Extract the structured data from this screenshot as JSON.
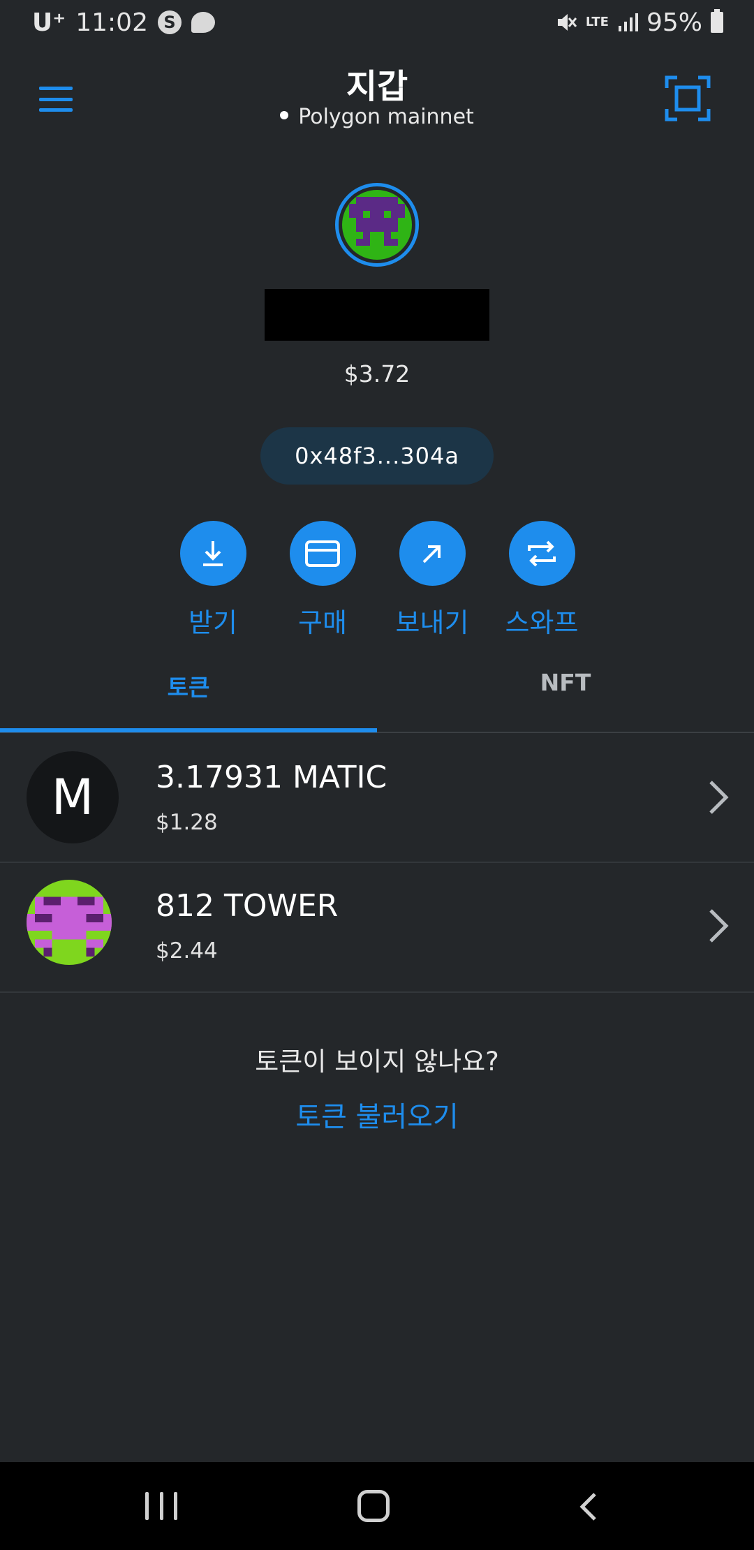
{
  "status_bar": {
    "carrier": "U⁺",
    "time": "11:02",
    "app_icon_letter": "S",
    "network_type": "LTE",
    "battery": "95%"
  },
  "header": {
    "title": "지갑",
    "network": "Polygon mainnet",
    "menu_icon": "hamburger-menu-icon",
    "scan_icon": "qr-scan-icon"
  },
  "account": {
    "balance": "$3.72",
    "address": "0x48f3...304a"
  },
  "actions": [
    {
      "label": "받기",
      "icon": "receive-download-icon"
    },
    {
      "label": "구매",
      "icon": "card-buy-icon"
    },
    {
      "label": "보내기",
      "icon": "send-arrow-icon"
    },
    {
      "label": "스와프",
      "icon": "swap-icon"
    }
  ],
  "tabs": [
    {
      "label": "토큰",
      "active": true
    },
    {
      "label": "NFT",
      "active": false
    }
  ],
  "tokens": [
    {
      "amount": "3.17931 MATIC",
      "value": "$1.28",
      "icon_letter": "M"
    },
    {
      "amount": "812 TOWER",
      "value": "$2.44"
    }
  ],
  "footer": {
    "missing_question": "토큰이 보이지 않나요?",
    "import_link": "토큰 불러오기"
  },
  "colors": {
    "background": "#24272a",
    "accent": "#1e8ded",
    "address_pill": "#1c3547"
  }
}
